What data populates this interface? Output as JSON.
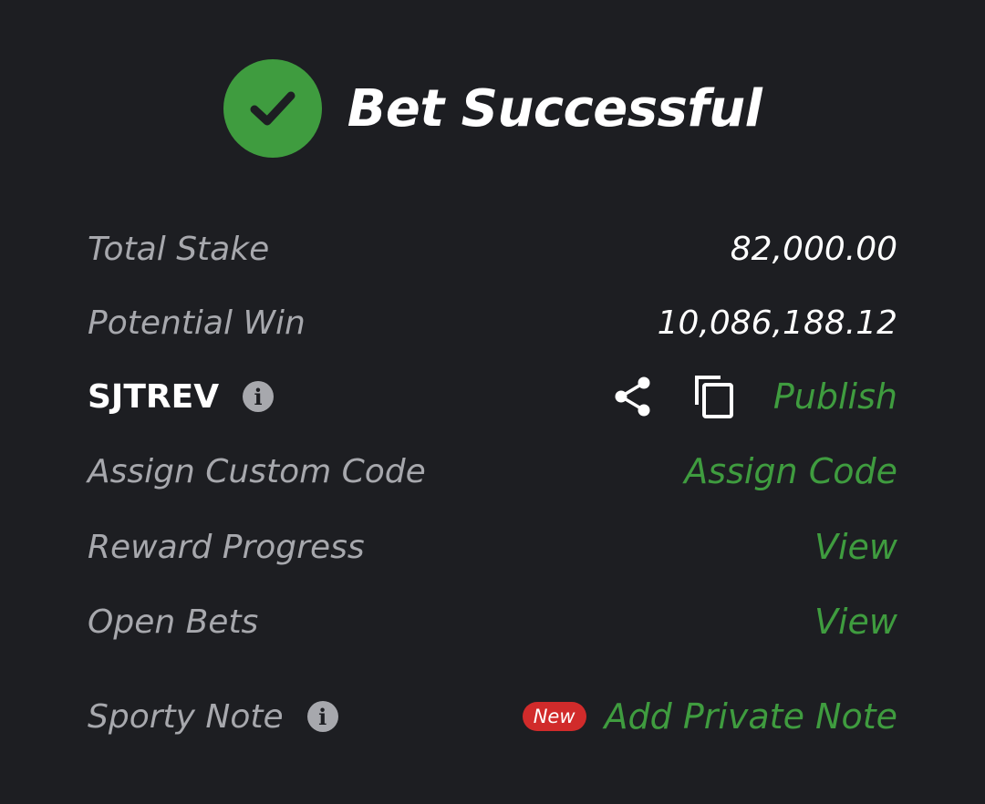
{
  "header": {
    "title": "Bet Successful",
    "icon": "checkmark-icon",
    "icon_color": "#3f9c3f"
  },
  "rows": {
    "total_stake": {
      "label": "Total Stake",
      "value": "82,000.00"
    },
    "potential_win": {
      "label": "Potential Win",
      "value": "10,086,188.12"
    },
    "booking_code": {
      "code": "SJTREV",
      "info_icon": "info-icon",
      "share_icon": "share-icon",
      "copy_icon": "copy-icon",
      "action": "Publish"
    },
    "custom_code": {
      "label": "Assign Custom Code",
      "action": "Assign Code"
    },
    "reward_progress": {
      "label": "Reward Progress",
      "action": "View"
    },
    "open_bets": {
      "label": "Open Bets",
      "action": "View"
    },
    "sporty_note": {
      "label": "Sporty Note",
      "info_icon": "info-icon",
      "badge": "New",
      "action": "Add Private Note"
    }
  },
  "colors": {
    "background": "#1d1e22",
    "accent_green": "#3f9c3f",
    "label_gray": "#a7a8ad",
    "badge_red": "#d12b2b"
  }
}
